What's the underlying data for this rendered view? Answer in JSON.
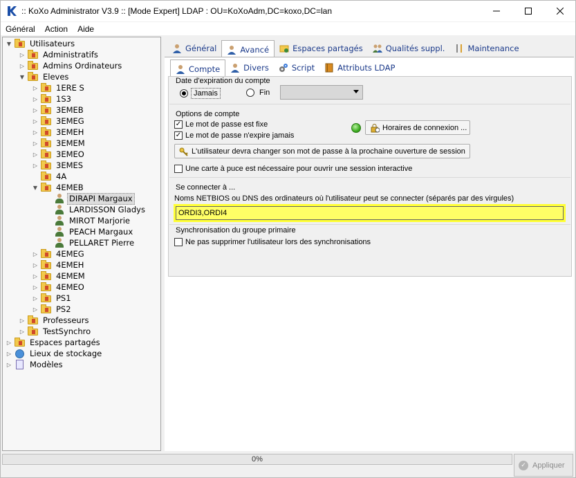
{
  "window": {
    "title": ":: KoXo Administrator V3.9 :: [Mode Expert] LDAP : OU=KoXoAdm,DC=koxo,DC=lan",
    "controls": {
      "minimize": "—",
      "maximize": "☐",
      "close": "✕"
    }
  },
  "menu": [
    "Général",
    "Action",
    "Aide"
  ],
  "tree": [
    {
      "label": "Utilisateurs",
      "icon": "folder-lock-icon",
      "twisty": "expanded"
    },
    {
      "label": "Administratifs",
      "icon": "folder-lock-icon",
      "twisty": "collapsed"
    },
    {
      "label": "Admins Ordinateurs",
      "icon": "folder-lock-icon",
      "twisty": "collapsed"
    },
    {
      "label": "Eleves",
      "icon": "folder-lock-icon",
      "twisty": "expanded"
    },
    {
      "label": "1ERE S",
      "icon": "folder-lock-icon",
      "twisty": "collapsed"
    },
    {
      "label": "1S3",
      "icon": "folder-lock-icon",
      "twisty": "collapsed"
    },
    {
      "label": "3EMEB",
      "icon": "folder-lock-icon",
      "twisty": "collapsed"
    },
    {
      "label": "3EMEG",
      "icon": "folder-lock-icon",
      "twisty": "collapsed"
    },
    {
      "label": "3EMEH",
      "icon": "folder-lock-icon",
      "twisty": "collapsed"
    },
    {
      "label": "3EMEM",
      "icon": "folder-lock-icon",
      "twisty": "collapsed"
    },
    {
      "label": "3EMEO",
      "icon": "folder-lock-icon",
      "twisty": "collapsed"
    },
    {
      "label": "3EMES",
      "icon": "folder-lock-icon",
      "twisty": "collapsed"
    },
    {
      "label": "4A",
      "icon": "folder-lock-icon",
      "twisty": "none"
    },
    {
      "label": "4EMEB",
      "icon": "folder-lock-icon",
      "twisty": "expanded"
    },
    {
      "label": "DIRAPI Margaux",
      "icon": "user-icon",
      "twisty": "none",
      "selected": true
    },
    {
      "label": "LARDISSON Gladys",
      "icon": "user-icon",
      "twisty": "none"
    },
    {
      "label": "MIROT Marjorie",
      "icon": "user-icon",
      "twisty": "none"
    },
    {
      "label": "PEACH Margaux",
      "icon": "user-icon",
      "twisty": "none"
    },
    {
      "label": "PELLARET Pierre",
      "icon": "user-icon",
      "twisty": "none"
    },
    {
      "label": "4EMEG",
      "icon": "folder-lock-icon",
      "twisty": "collapsed"
    },
    {
      "label": "4EMEH",
      "icon": "folder-lock-icon",
      "twisty": "collapsed"
    },
    {
      "label": "4EMEM",
      "icon": "folder-lock-icon",
      "twisty": "collapsed"
    },
    {
      "label": "4EMEO",
      "icon": "folder-lock-icon",
      "twisty": "collapsed"
    },
    {
      "label": "PS1",
      "icon": "folder-lock-icon",
      "twisty": "collapsed"
    },
    {
      "label": "PS2",
      "icon": "folder-lock-icon",
      "twisty": "collapsed"
    },
    {
      "label": "Professeurs",
      "icon": "folder-lock-icon",
      "twisty": "collapsed"
    },
    {
      "label": "TestSynchro",
      "icon": "folder-lock-icon",
      "twisty": "collapsed"
    },
    {
      "label": "Espaces partagés",
      "icon": "shared-folder-icon",
      "twisty": "collapsed"
    },
    {
      "label": "Lieux de stockage",
      "icon": "storage-icon",
      "twisty": "collapsed"
    },
    {
      "label": "Modèles",
      "icon": "models-icon",
      "twisty": "collapsed"
    }
  ],
  "tabs": [
    {
      "label": "Général",
      "icon": "user-icon",
      "active": false
    },
    {
      "label": "Avancé",
      "icon": "user-icon",
      "active": true
    },
    {
      "label": "Espaces partagés",
      "icon": "shared-folder-icon",
      "active": false
    },
    {
      "label": "Qualités suppl.",
      "icon": "users-icon",
      "active": false
    },
    {
      "label": "Maintenance",
      "icon": "tools-icon",
      "active": false
    }
  ],
  "subtabs": [
    {
      "label": "Compte",
      "icon": "user-icon",
      "active": true
    },
    {
      "label": "Divers",
      "icon": "user-icon",
      "active": false
    },
    {
      "label": "Script",
      "icon": "gears-icon",
      "active": false
    },
    {
      "label": "Attributs LDAP",
      "icon": "book-icon",
      "active": false
    }
  ],
  "expiration": {
    "title": "Date d'expiration du compte",
    "jamais": "Jamais",
    "fin": "Fin",
    "selected": "jamais"
  },
  "options": {
    "title": "Options de compte",
    "pwd_fixed": "Le mot de passe est fixe",
    "pwd_never_expire": "Le mot de passe n'expire jamais",
    "hours_button": "Horaires de connexion ...",
    "change_pwd_button": "L'utilisateur devra changer son mot de passe à la prochaine ouverture de session",
    "smartcard": "Une carte à puce est nécessaire pour ouvrir une session interactive",
    "pwd_fixed_checked": true,
    "pwd_never_expire_checked": true,
    "smartcard_checked": false
  },
  "connect": {
    "title": "Se connecter à ...",
    "description": "Noms NETBIOS ou DNS des ordinateurs où l'utilisateur peut se connecter (séparés par des virgules)",
    "value": "ORDI3,ORDI4"
  },
  "sync": {
    "title": "Synchronisation du groupe primaire",
    "no_delete": "Ne pas supprimer l'utilisateur lors des synchronisations",
    "no_delete_checked": false
  },
  "status": {
    "progress_text": "0%",
    "progress": 0,
    "apply": "Appliquer"
  },
  "colors": {
    "highlight_field": "#ffff66",
    "tab_text": "#1b3a8a",
    "status_led": "#3eae22"
  }
}
